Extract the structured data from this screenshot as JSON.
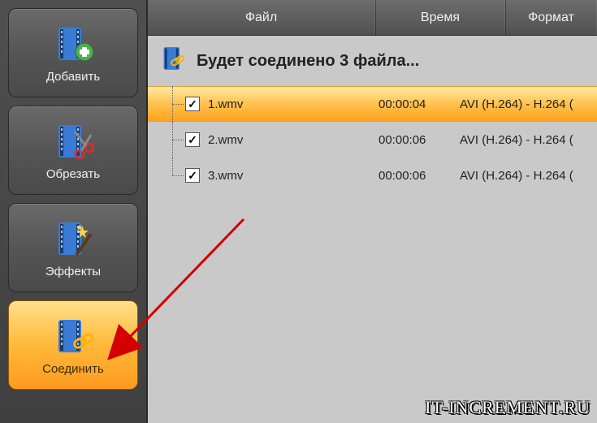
{
  "sidebar": {
    "items": [
      {
        "label": "Добавить",
        "icon": "add"
      },
      {
        "label": "Обрезать",
        "icon": "cut"
      },
      {
        "label": "Эффекты",
        "icon": "fx"
      },
      {
        "label": "Соединить",
        "icon": "merge"
      }
    ]
  },
  "columns": {
    "file": "Файл",
    "time": "Время",
    "format": "Формат"
  },
  "merge": {
    "title": "Будет соединено 3 файла..."
  },
  "files": [
    {
      "name": "1.wmv",
      "time": "00:00:04",
      "format": "AVI (H.264) - H.264 (",
      "checked": true,
      "selected": true
    },
    {
      "name": "2.wmv",
      "time": "00:00:06",
      "format": "AVI (H.264) - H.264 (",
      "checked": true,
      "selected": false
    },
    {
      "name": "3.wmv",
      "time": "00:00:06",
      "format": "AVI (H.264) - H.264 (",
      "checked": true,
      "selected": false
    }
  ],
  "watermark": "IT-INCREMENT.RU"
}
